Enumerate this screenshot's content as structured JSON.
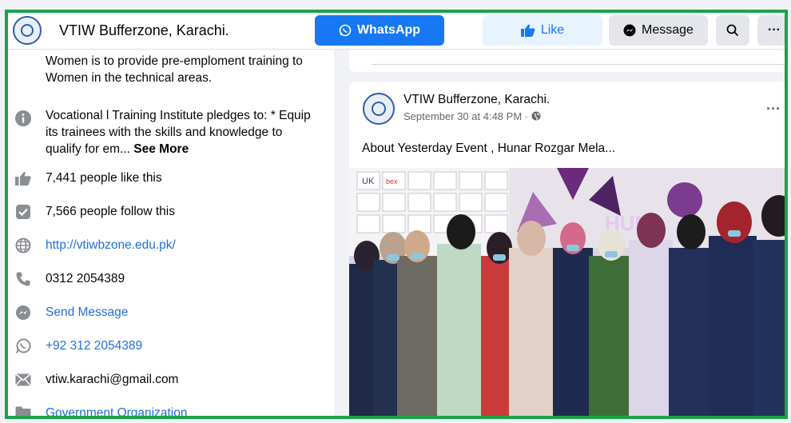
{
  "header": {
    "page_name": "VTIW Bufferzone, Karachi.",
    "buttons": {
      "whatsapp": "WhatsApp",
      "like": "Like",
      "message": "Message",
      "more": "···"
    }
  },
  "intro": {
    "text": "Women is to provide pre-emploment training to Women in the technical areas.",
    "pledge_text": "Vocational l Training Institute pledges to: * Equip its trainees with the skills and knowledge to qualify for em...",
    "see_more": "See More"
  },
  "info": {
    "likes": "7,441 people like this",
    "follows": "7,566 people follow this",
    "website": "http://vtiwbzone.edu.pk/",
    "phone": "0312 2054389",
    "send_message": "Send Message",
    "whatsapp_number": "+92 312 2054389",
    "email": "vtiw.karachi@gmail.com",
    "category": "Government Organization"
  },
  "post": {
    "author": "VTIW Bufferzone, Karachi.",
    "time": "September 30 at 4:48 PM ·",
    "text": "About Yesterday Event , Hunar Rozgar Mela...",
    "more": "···",
    "photo_signage": [
      "UK",
      "bex",
      "HUN"
    ]
  },
  "colors": {
    "accent": "#1877f2",
    "link": "#216fdb",
    "border_highlight": "#1aa34a",
    "background": "#f0f2f5"
  }
}
